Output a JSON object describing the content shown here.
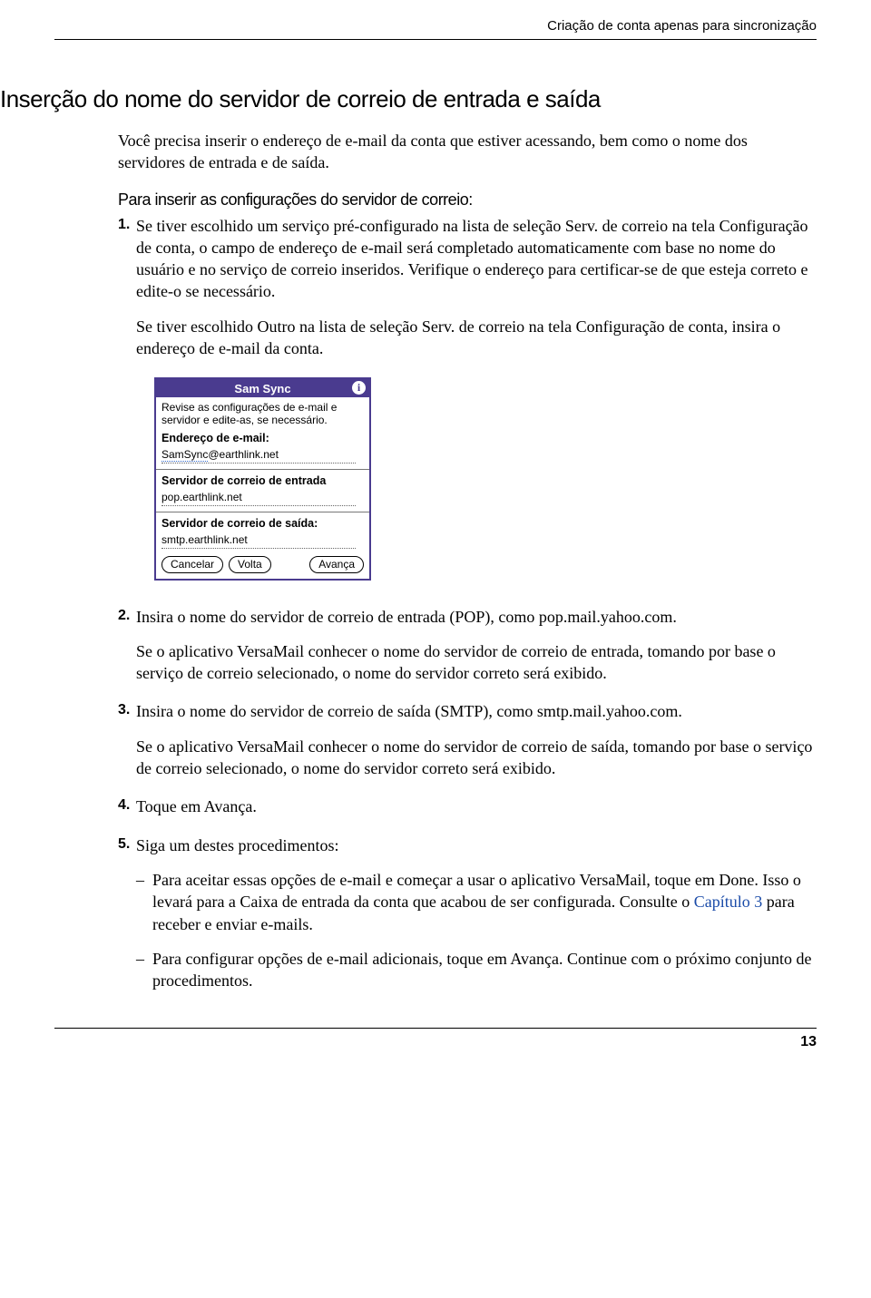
{
  "header": {
    "running": "Criação de conta apenas para sincronização"
  },
  "section": {
    "title": "Inserção do nome do servidor de correio de entrada e saída",
    "intro": "Você precisa inserir o endereço de e-mail da conta que estiver acessando, bem como o nome dos servidores de entrada e de saída.",
    "subhead": "Para inserir as configurações do servidor de correio:"
  },
  "steps": {
    "s1": {
      "num": "1.",
      "text": "Se tiver escolhido um serviço pré-configurado na lista de seleção Serv. de correio na tela Configuração de conta, o campo de endereço de e-mail será completado automaticamente com base no nome do usuário e no serviço de correio inseridos. Verifique o endereço para certificar-se de que esteja correto e edite-o se necessário.",
      "para2": "Se tiver escolhido Outro na lista de seleção Serv. de correio na tela Configuração de conta, insira o endereço de e-mail da conta."
    },
    "s2": {
      "num": "2.",
      "text": "Insira o nome do servidor de correio de entrada (POP), como pop.mail.yahoo.com.",
      "para2": "Se o aplicativo VersaMail conhecer o nome do servidor de correio de entrada, tomando por base o serviço de correio selecionado, o nome do servidor correto será exibido."
    },
    "s3": {
      "num": "3.",
      "text": "Insira o nome do servidor de correio de saída (SMTP), como smtp.mail.yahoo.com.",
      "para2": "Se o aplicativo VersaMail conhecer o nome do servidor de correio de saída, tomando por base o serviço de correio selecionado, o nome do servidor correto será exibido."
    },
    "s4": {
      "num": "4.",
      "text": "Toque em Avança."
    },
    "s5": {
      "num": "5.",
      "text": "Siga um destes procedimentos:",
      "sub1a": "Para aceitar essas opções de e-mail e começar a usar o aplicativo VersaMail, toque em Done. Isso o levará para a Caixa de entrada da conta que acabou de ser configurada. Consulte o ",
      "sub1link": "Capítulo 3",
      "sub1b": " para receber e enviar e-mails.",
      "sub2": "Para configurar opções de e-mail adicionais, toque em Avança. Continue com o próximo conjunto de procedimentos."
    }
  },
  "palm": {
    "title": "Sam Sync",
    "infoGlyph": "i",
    "instr": "Revise as configurações de e-mail e servidor e edite-as, se necessário.",
    "emailLabel": "Endereço de e-mail:",
    "emailUser": "SamSync",
    "emailDomain": "@earthlink.net",
    "incomingLabel": "Servidor de correio de entrada",
    "incomingVal": "pop.earthlink.net",
    "outgoingLabel": "Servidor de correio de saída:",
    "outgoingVal": "smtp.earthlink.net",
    "btnCancel": "Cancelar",
    "btnBack": "Volta",
    "btnNext": "Avança"
  },
  "footer": {
    "pageNumber": "13"
  }
}
